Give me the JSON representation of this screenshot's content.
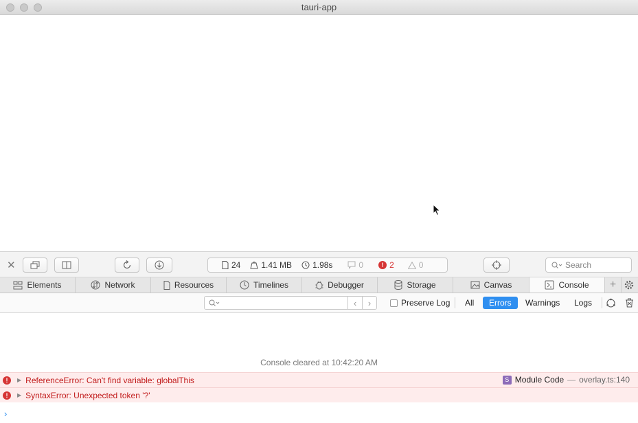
{
  "window": {
    "title": "tauri-app"
  },
  "toolbar": {
    "activity": {
      "resources": "24",
      "size": "1.41 MB",
      "time": "1.98s",
      "logs": "0",
      "errors": "2",
      "warnings": "0"
    },
    "search_placeholder": "Search"
  },
  "tabs": [
    {
      "label": "Elements",
      "icon": "elements-icon"
    },
    {
      "label": "Network",
      "icon": "network-icon"
    },
    {
      "label": "Resources",
      "icon": "resources-icon"
    },
    {
      "label": "Timelines",
      "icon": "timelines-icon"
    },
    {
      "label": "Debugger",
      "icon": "debugger-icon"
    },
    {
      "label": "Storage",
      "icon": "storage-icon"
    },
    {
      "label": "Canvas",
      "icon": "canvas-icon"
    },
    {
      "label": "Console",
      "icon": "console-icon",
      "active": true
    }
  ],
  "filter": {
    "preserve_log": "Preserve Log",
    "levels": [
      "All",
      "Errors",
      "Warnings",
      "Logs"
    ],
    "active_level": "Errors"
  },
  "console": {
    "cleared": "Console cleared at 10:42:20 AM",
    "messages": [
      {
        "text": "ReferenceError: Can't find variable: globalThis",
        "source_badge": "S",
        "source_label": "Module Code",
        "separator": "—",
        "location": "overlay.ts:140"
      },
      {
        "text": "SyntaxError: Unexpected token '?'"
      }
    ]
  },
  "colors": {
    "accent": "#2f8ff0",
    "error": "#d63535",
    "error_bg": "#feecec"
  }
}
